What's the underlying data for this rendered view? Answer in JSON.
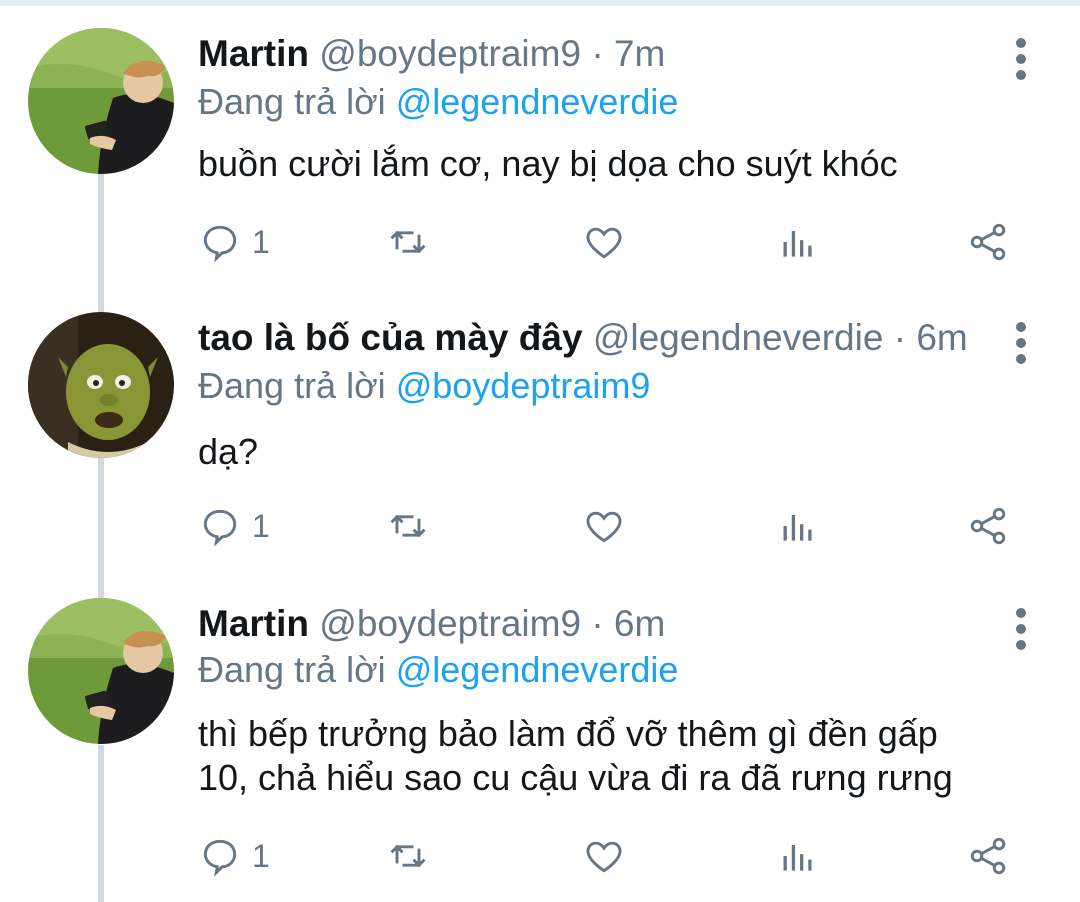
{
  "colors": {
    "text": "#14171a",
    "muted": "#657786",
    "link": "#1da1f2",
    "thread_line": "#cfd9de"
  },
  "reply_prefix": "Đang trả lời",
  "tweets": [
    {
      "name": "Martin",
      "handle": "@boydeptraim9",
      "separator": "·",
      "time": "7m",
      "replying_to": "@legendneverdie",
      "text_lines": [
        "buồn cười lắm cơ, nay bị dọa cho suýt khóc"
      ],
      "reply_count": "1",
      "avatar_icon": "person-on-grass-avatar"
    },
    {
      "name": "tao là bố của mày đây",
      "handle": "@legendneverdie",
      "separator": "·",
      "time": "6m",
      "replying_to": "@boydeptraim9",
      "text_lines": [
        "dạ?"
      ],
      "reply_count": "1",
      "avatar_icon": "shrek-avatar"
    },
    {
      "name": "Martin",
      "handle": "@boydeptraim9",
      "separator": "·",
      "time": "6m",
      "replying_to": "@legendneverdie",
      "text_lines": [
        "thì bếp trưởng bảo làm đổ vỡ thêm gì đền gấp",
        "10, chả hiểu sao cu cậu vừa đi ra đã rưng rưng"
      ],
      "reply_count": "1",
      "avatar_icon": "person-on-grass-avatar"
    }
  ],
  "action_icons": [
    "reply-icon",
    "retweet-icon",
    "like-icon",
    "analytics-icon",
    "share-icon"
  ]
}
